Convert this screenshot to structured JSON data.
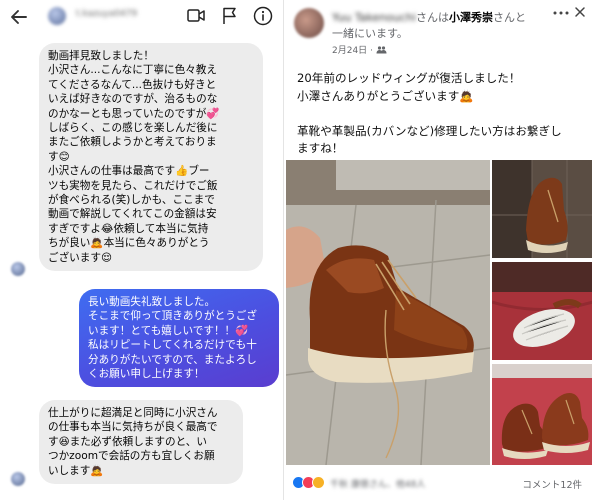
{
  "chat": {
    "header_name": "t.kazuya0479",
    "messages": [
      {
        "dir": "in",
        "text": "動画拝見致しました！\n小沢さん...こんなに丁寧に色々教え\nてくださるなんて...色抜けも好きと\nいえば好きなのですが、治るものな\nのかなーとも思っていたのですが💞\nしばらく、この感じを楽しんだ後に\nまたご依頼しようかと考えておりま\nす😊\n小沢さんの仕事は最高です👍ブー\nツも実物を見たら、これだけでご飯\nが食べられる(笑)しかも、ここまで\n動画で解説してくれてこの金額は安\nすぎですよ😂依頼して本当に気持\nちが良い🙇本当に色々ありがとう\nございます😌"
      },
      {
        "dir": "out",
        "text": "長い動画失礼致しました。\nそこまで仰って頂きありがとうござ\nいます！とても嬉しいです！！💞\n私はリピートしてくれるだけでも十\n分ありがたいですので、またよろし\nくお願い申し上げます！"
      },
      {
        "dir": "in",
        "text": "仕上がりに超満足と同時に小沢さん\nの仕事も本当に気持ちが良く最高で\nす😆また必ず依頼しますのと、い\nつかzoomで会話の方も宜しくお願\nいします🙇"
      }
    ]
  },
  "post": {
    "author_blur": "Yuu Takenouchi",
    "with_prefix": "さんは",
    "with_name": "小澤秀崇",
    "with_suffix": "さんと",
    "line2": "一緒にいます。",
    "date": "2月24日",
    "separator": "·",
    "body": "20年前のレッドウィングが復活しました！\n小澤さんありがとうございます🙇\n\n革靴や革製品(カバンなど)修理したい方はお繋ぎし\nますね！",
    "reaction_names": "千秋 康徳さん、他48人",
    "comment_count": "コメント12件"
  },
  "icons": {
    "header": [
      "back-arrow-icon",
      "video-call-icon",
      "flag-icon",
      "info-icon"
    ],
    "post": [
      "more-options-icon",
      "close-icon",
      "audience-friends-icon"
    ],
    "reactions": [
      "like-icon",
      "love-icon",
      "wow-icon"
    ]
  },
  "colors": {
    "outgoing_bubble": "#4a5be8",
    "incoming_bubble": "#ececec",
    "like": "#1877f2",
    "love": "#f33e58",
    "wow": "#f7b125"
  }
}
